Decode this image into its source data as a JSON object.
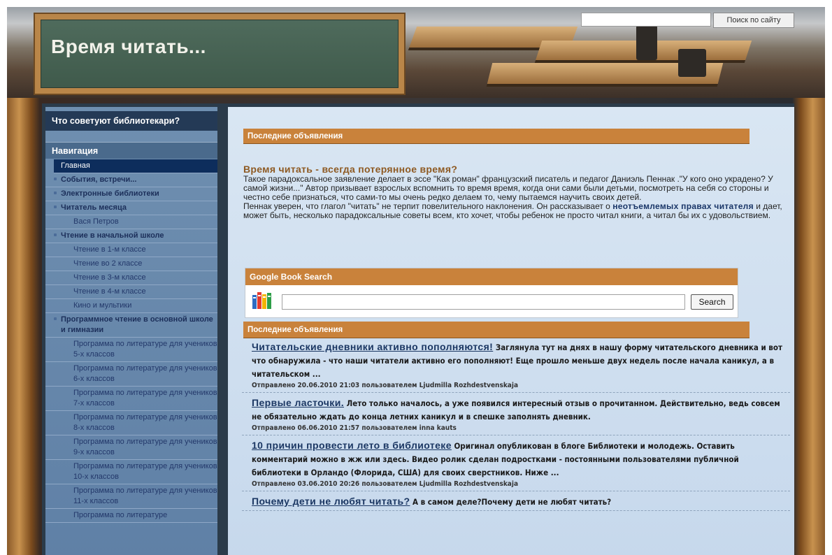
{
  "header": {
    "site_title": "Время читать...",
    "search_placeholder": "",
    "search_button": "Поиск по сайту"
  },
  "sidebar": {
    "advice_heading": "Что советуют библиотекари?",
    "nav_heading": "Навигация",
    "items": [
      {
        "label": "Главная",
        "style": "active"
      },
      {
        "label": "События, встречи...",
        "style": "bold"
      },
      {
        "label": "Электронные библиотеки",
        "style": "bold"
      },
      {
        "label": "Читатель месяца",
        "style": "bold"
      },
      {
        "label": "Вася Петров",
        "style": "sub"
      },
      {
        "label": "Чтение в начальной школе",
        "style": "bold"
      },
      {
        "label": "Чтение в 1-м классе",
        "style": "sub"
      },
      {
        "label": "Чтение во 2 классе",
        "style": "sub"
      },
      {
        "label": "Чтение в 3-м классе",
        "style": "sub"
      },
      {
        "label": "Чтение в 4-м классе",
        "style": "sub"
      },
      {
        "label": "Кино и мультики",
        "style": "sub"
      },
      {
        "label": "Программное чтение в основной школе и гимназии",
        "style": "bold"
      },
      {
        "label": "Программа по литературе для учеников 5-х классов",
        "style": "sub2"
      },
      {
        "label": "Программа по литературе для учеников 6-х классов",
        "style": "sub2"
      },
      {
        "label": "Программа по литературе для учеников 7-х классов",
        "style": "sub2"
      },
      {
        "label": "Программа по литературе для учеников 8-х классов",
        "style": "sub2"
      },
      {
        "label": "Программа по литературе для учеников 9-х классов",
        "style": "sub2"
      },
      {
        "label": "Программа по литературе для учеников 10-х классов",
        "style": "sub2"
      },
      {
        "label": "Программа по литературе для учеников 11-х классов",
        "style": "sub2"
      },
      {
        "label": "Программа по литературе",
        "style": "sub2"
      }
    ]
  },
  "main": {
    "announcements_label_1": "Последние объявления",
    "article": {
      "title": "Время читать - всегда потерянное время?",
      "p1": "Такое парадоксальное заявление делает в эссе \"Как роман\" французский писатель и педагог Даниэль Пеннак .\"У кого оно украдено? У самой жизни...\" Автор призывает взрослых вспомнить то время время, когда они сами были детьми, посмотреть на себя со стороны и честно себе признаться, что сами-то мы очень редко делаем то, чему  пытаемся научить своих детей.",
      "p2_before": "Пеннак  уверен, что глагол \"читать\" не терпит повелительного наклонения. Он  рассказывает о ",
      "p2_link": "неотъемлемых правах читателя",
      "p2_after": " и дает, может быть, несколько парадоксальные советы всем, кто хочет, чтобы ребенок не просто читал книги, а читал бы их с удовольствием."
    },
    "google_book_search": {
      "title": "Google Book Search",
      "button": "Search",
      "icon": "books-icon"
    },
    "announcements_label_2": "Последние объявления",
    "news": [
      {
        "title": "Читательские дневники активно пополняются!",
        "text": " Заглянула тут на днях в нашу форму читательского дневника и вот что обнаружила - что наши читатели активно его пополняют! Еще прошло меньше двух недель после начала каникул, а в читательском ...",
        "meta": "Отправлено 20.06.2010 21:03 пользователем Ljudmilla Rozhdestvenskaja"
      },
      {
        "title": "Первые ласточки.",
        "text": " Лето только началось, а уже появился интересный отзыв о прочитанном. Действительно, ведь совсем не обязательно ждать до конца летних каникул и в спешке заполнять дневник.",
        "meta": "Отправлено 06.06.2010 21:57 пользователем inna kauts"
      },
      {
        "title": "10 причин провести лето в библиотеке",
        "text": " Оригинал опубликован в блоге Библиотеки и молодежь. Оставить комментарий можно в жж или здесь. Видео ролик  сделан  подростками - постоянными пользователями  публичной библиотеки в  Орландо (Флорида, США)  для  своих  сверстников.   Ниже ...",
        "meta": "Отправлено 03.06.2010 20:26 пользователем Ljudmilla Rozhdestvenskaja"
      },
      {
        "title": "Почему дети не любят читать?",
        "text": " А в самом деле?Почему дети не любят читать?",
        "meta": ""
      }
    ]
  },
  "colors": {
    "accent_orange": "#c9823b",
    "nav_active": "#0d2d5c",
    "chalkboard": "#4f6b5c"
  }
}
